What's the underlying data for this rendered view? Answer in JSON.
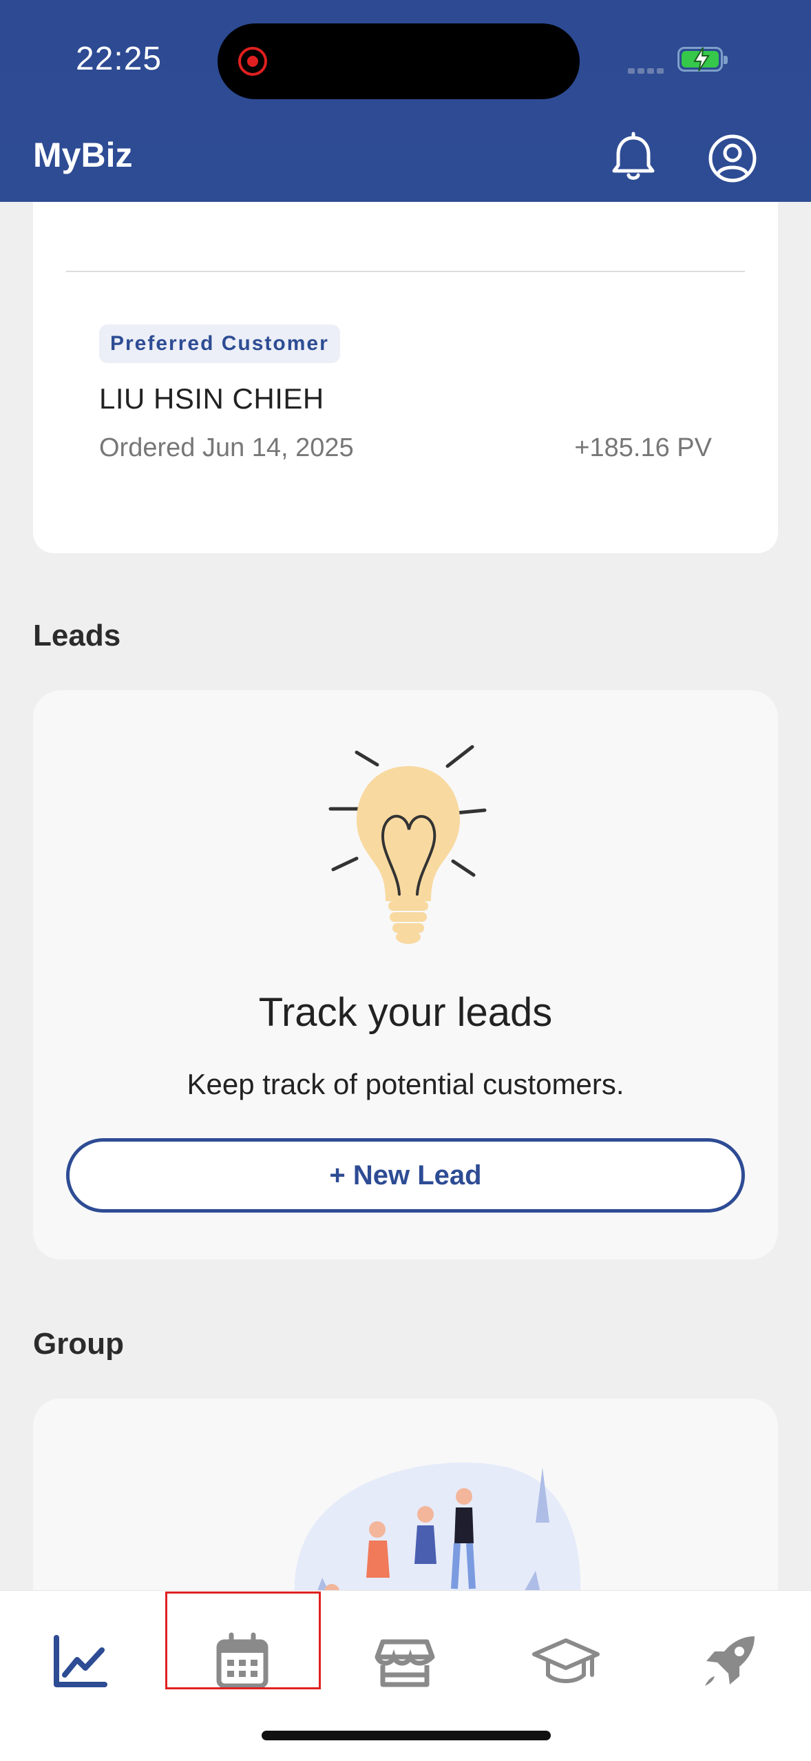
{
  "status_bar": {
    "time": "22:25"
  },
  "header": {
    "app_title": "MyBiz",
    "icons": [
      "bell-icon",
      "profile-icon"
    ]
  },
  "recent_order": {
    "badge": "Preferred Customer",
    "customer_name": "LIU HSIN CHIEH",
    "ordered": "Ordered Jun 14, 2025",
    "pv": "+185.16 PV"
  },
  "leads": {
    "section_title": "Leads",
    "title": "Track your leads",
    "subtitle": "Keep track of potential customers.",
    "button_label": "+ New Lead"
  },
  "group": {
    "section_title": "Group"
  },
  "bottom_nav": {
    "items": [
      {
        "icon": "chart-line-icon",
        "active": true
      },
      {
        "icon": "calendar-icon",
        "active": false
      },
      {
        "icon": "store-icon",
        "active": false
      },
      {
        "icon": "graduation-cap-icon",
        "active": false
      },
      {
        "icon": "rocket-icon",
        "active": false
      }
    ]
  },
  "colors": {
    "brand": "#2e4c94",
    "accent_bulb": "#f8d9a0",
    "highlight": "#e02020"
  }
}
